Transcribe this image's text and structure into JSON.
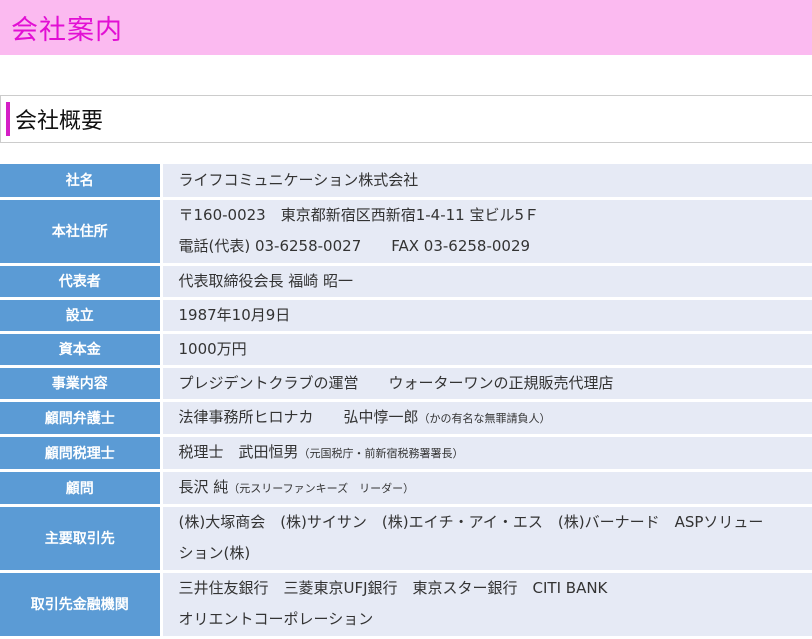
{
  "header": {
    "title": "会社案内"
  },
  "section": {
    "title": "会社概要"
  },
  "rows": {
    "name": {
      "label": "社名",
      "value": "ライフコミュニケーション株式会社"
    },
    "address": {
      "label": "本社住所",
      "line1": "〒160-0023　東京都新宿区西新宿1-4-11 宝ビル5Ｆ",
      "tel": "電話(代表) 03-6258-0027",
      "fax": "FAX 03-6258-0029"
    },
    "rep": {
      "label": "代表者",
      "value": "代表取締役会長 福崎 昭一"
    },
    "founded": {
      "label": "設立",
      "value": "1987年10月9日"
    },
    "capital": {
      "label": "資本金",
      "value": "1000万円"
    },
    "business": {
      "label": "事業内容",
      "item1": "プレジデントクラブの運営",
      "item2": "ウォーターワンの正規販売代理店"
    },
    "lawyer": {
      "label": "顧問弁護士",
      "firm": "法律事務所ヒロナカ",
      "name": "弘中惇一郎",
      "note": "（かの有名な無罪請負人）"
    },
    "taxadvisor": {
      "label": "顧問税理士",
      "name": "税理士　武田恒男",
      "note": "（元国税庁・前新宿税務署署長）"
    },
    "advisor": {
      "label": "顧問",
      "name": "長沢 純",
      "note": "（元スリーファンキーズ　リーダー）"
    },
    "clients": {
      "label": "主要取引先",
      "line1": "(株)大塚商会　(株)サイサン　(株)エイチ・アイ・エス　(株)バーナード　ASPソリュー",
      "line2": "ション(株)"
    },
    "banks": {
      "label": "取引先金融機関",
      "line1": "三井住友銀行　三菱東京UFJ銀行　東京スター銀行　CITI BANK",
      "line2": "オリエントコーポレーション"
    }
  },
  "colors": {
    "header_bg": "#fbbaf0",
    "title": "#e20fd4",
    "accent_bar": "#d51fc6",
    "label_bg": "#5b9bd5",
    "value_bg": "#e6eaf5"
  }
}
